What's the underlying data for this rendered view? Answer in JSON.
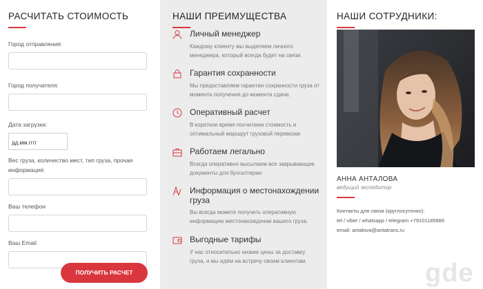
{
  "calc": {
    "title": "РАСЧИТАТЬ СТОИМОСТЬ",
    "from_label": "Город отправления:",
    "to_label": "Город получателя:",
    "date_label": "Дата загрузки:",
    "date_placeholder": "дд.мм.гггг",
    "cargo_label": "Вес груза, количество мест, тип груза, прочая информация:",
    "phone_label": "Ваш телефон",
    "email_label": "Ваш Email",
    "submit_label": "ПОЛУЧИТЬ РАСЧЕТ"
  },
  "advantages": {
    "title": "НАШИ ПРЕИМУЩЕСТВА",
    "items": [
      {
        "title": "Личный менеджер",
        "desc": "Каждому клиенту мы выделяем личного менеджера, который всегда будет на связи.",
        "icon": "person-icon"
      },
      {
        "title": "Гарантия сохранности",
        "desc": "Мы предоставляем гарантии сохранности груза от момента получения до момента сдачи.",
        "icon": "lock-icon"
      },
      {
        "title": "Оперативный расчет",
        "desc": "В короткое время посчитаем стоимость и оптимальный маршрут грузовой перевозки",
        "icon": "clock-icon"
      },
      {
        "title": "Работаем легально",
        "desc": "Всегда оперативно высылаем все закрывающие документы для бухгалтерии",
        "icon": "briefcase-icon"
      },
      {
        "title": "Информация о местонахождении груза",
        "desc": "Вы всегда можете получить оперативную информацию местонахождении вашего груза.",
        "icon": "map-icon"
      },
      {
        "title": "Выгодные тарифы",
        "desc": "У нас относительно низкие цены за доставку груза, и мы идём на встречу своим клиентам.",
        "icon": "wallet-icon"
      }
    ]
  },
  "staff": {
    "title": "НАШИ СОТРУДНИКИ:",
    "name": "АННА АНТАЛОВА",
    "role": "ведущий экспедитор",
    "contacts_label": "Контакты для связи (круглосуточно):",
    "phone_line": "tel / viber / whatsapp / telegram +79101185666",
    "email_line": "email: antalova@antatrans.ru"
  },
  "watermark": "gde",
  "colors": {
    "accent": "#d9363e",
    "panel": "#ececec"
  }
}
